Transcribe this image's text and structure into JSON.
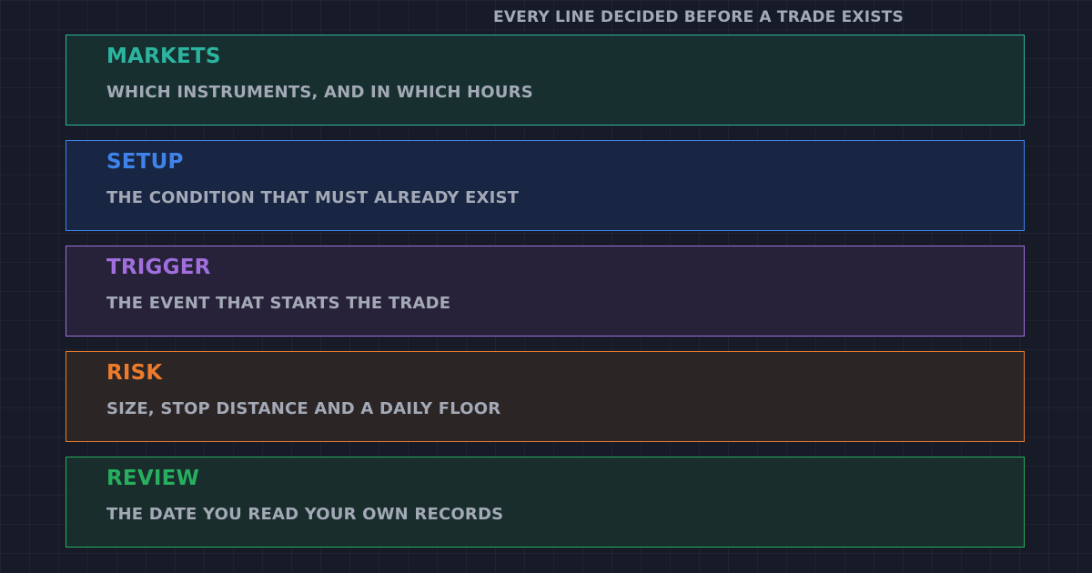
{
  "caption": "EVERY LINE DECIDED BEFORE A TRADE EXISTS",
  "blocks": [
    {
      "title": "MARKETS",
      "description": "WHICH INSTRUMENTS, AND IN WHICH HOURS",
      "color": "#2bb5a0",
      "fill": "#17302f"
    },
    {
      "title": "SETUP",
      "description": "THE CONDITION THAT MUST ALREADY EXIST",
      "color": "#3f83ea",
      "fill": "#182643"
    },
    {
      "title": "TRIGGER",
      "description": "THE EVENT THAT STARTS THE TRADE",
      "color": "#a06fdd",
      "fill": "#27223a"
    },
    {
      "title": "RISK",
      "description": "SIZE, STOP DISTANCE AND A DAILY FLOOR",
      "color": "#ec7c2b",
      "fill": "#2c2526"
    },
    {
      "title": "REVIEW",
      "description": "THE DATE YOU READ YOUR OWN RECORDS",
      "color": "#27ae5e",
      "fill": "#182d2c"
    }
  ]
}
